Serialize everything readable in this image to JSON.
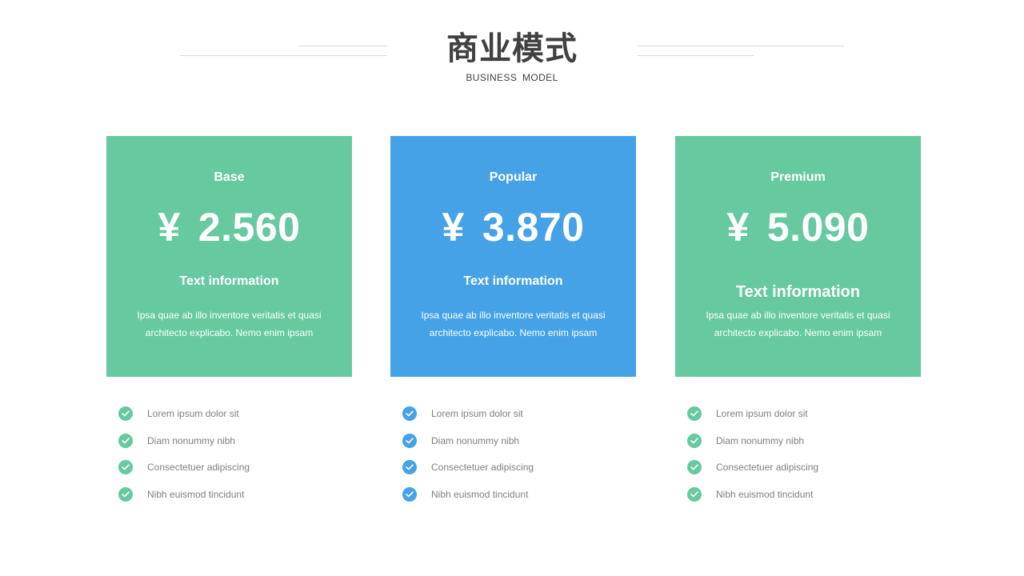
{
  "header": {
    "title": "商业模式",
    "subtitle": "BUSINESS  MODEL"
  },
  "colors": {
    "green": "#66c9a0",
    "blue": "#45a2e6",
    "title_text": "#404040",
    "feature_text": "#7f7f7f"
  },
  "plans": [
    {
      "name": "Base",
      "currency": "¥",
      "price": "2.560",
      "info_title": "Text information",
      "desc_line1": "Ipsa quae ab illo inventore veritatis et quasi",
      "desc_line2": "architecto explicabo. Nemo enim ipsam",
      "color": "green",
      "features": [
        "Lorem ipsum dolor sit",
        "Diam nonummy nibh",
        "Consectetuer adipiscing",
        "Nibh euismod tincidunt"
      ]
    },
    {
      "name": "Popular",
      "currency": "¥",
      "price": "3.870",
      "info_title": "Text information",
      "desc_line1": "Ipsa quae ab illo inventore veritatis et quasi",
      "desc_line2": "architecto explicabo. Nemo enim ipsam",
      "color": "blue",
      "features": [
        "Lorem ipsum dolor sit",
        "Diam nonummy nibh",
        "Consectetuer adipiscing",
        "Nibh euismod tincidunt"
      ]
    },
    {
      "name": "Premium",
      "currency": "¥",
      "price": "5.090",
      "info_title": "Text information",
      "desc_line1": "Ipsa quae ab illo inventore veritatis et quasi",
      "desc_line2": "architecto explicabo. Nemo enim ipsam",
      "color": "green",
      "features": [
        "Lorem ipsum dolor sit",
        "Diam nonummy nibh",
        "Consectetuer adipiscing",
        "Nibh euismod tincidunt"
      ]
    }
  ],
  "icons": {
    "feature_bullet": "check-circle-icon"
  }
}
